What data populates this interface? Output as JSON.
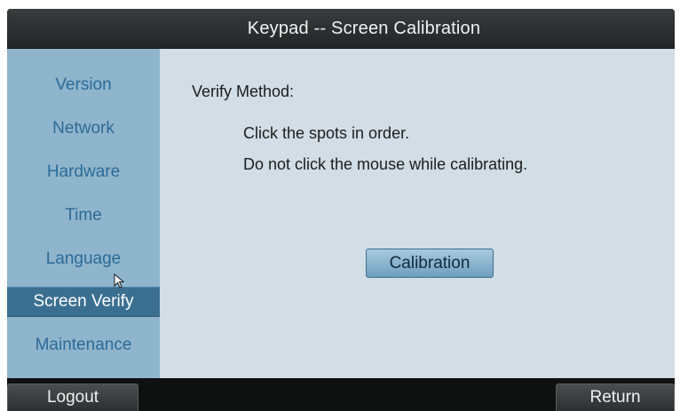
{
  "window": {
    "title": "Keypad -- Screen Calibration"
  },
  "sidebar": {
    "items": [
      {
        "label": "Version",
        "active": false
      },
      {
        "label": "Network",
        "active": false
      },
      {
        "label": "Hardware",
        "active": false
      },
      {
        "label": "Time",
        "active": false
      },
      {
        "label": "Language",
        "active": false
      },
      {
        "label": "Screen Verify",
        "active": true
      },
      {
        "label": "Maintenance",
        "active": false
      }
    ]
  },
  "main": {
    "heading": "Verify Method:",
    "instructions": [
      "Click the spots in order.",
      "Do not click the mouse while calibrating."
    ],
    "calibration_label": "Calibration"
  },
  "footer": {
    "logout_label": "Logout",
    "return_label": "Return"
  },
  "colors": {
    "sidebar_bg": "#8fb5cd",
    "sidebar_text": "#2b6a97",
    "active_item_bg": "#3b6f91",
    "content_bg": "#d2dde5",
    "titlebar_bg": "#2e2f31"
  },
  "icons": {
    "pointer": "mouse-pointer-icon"
  }
}
